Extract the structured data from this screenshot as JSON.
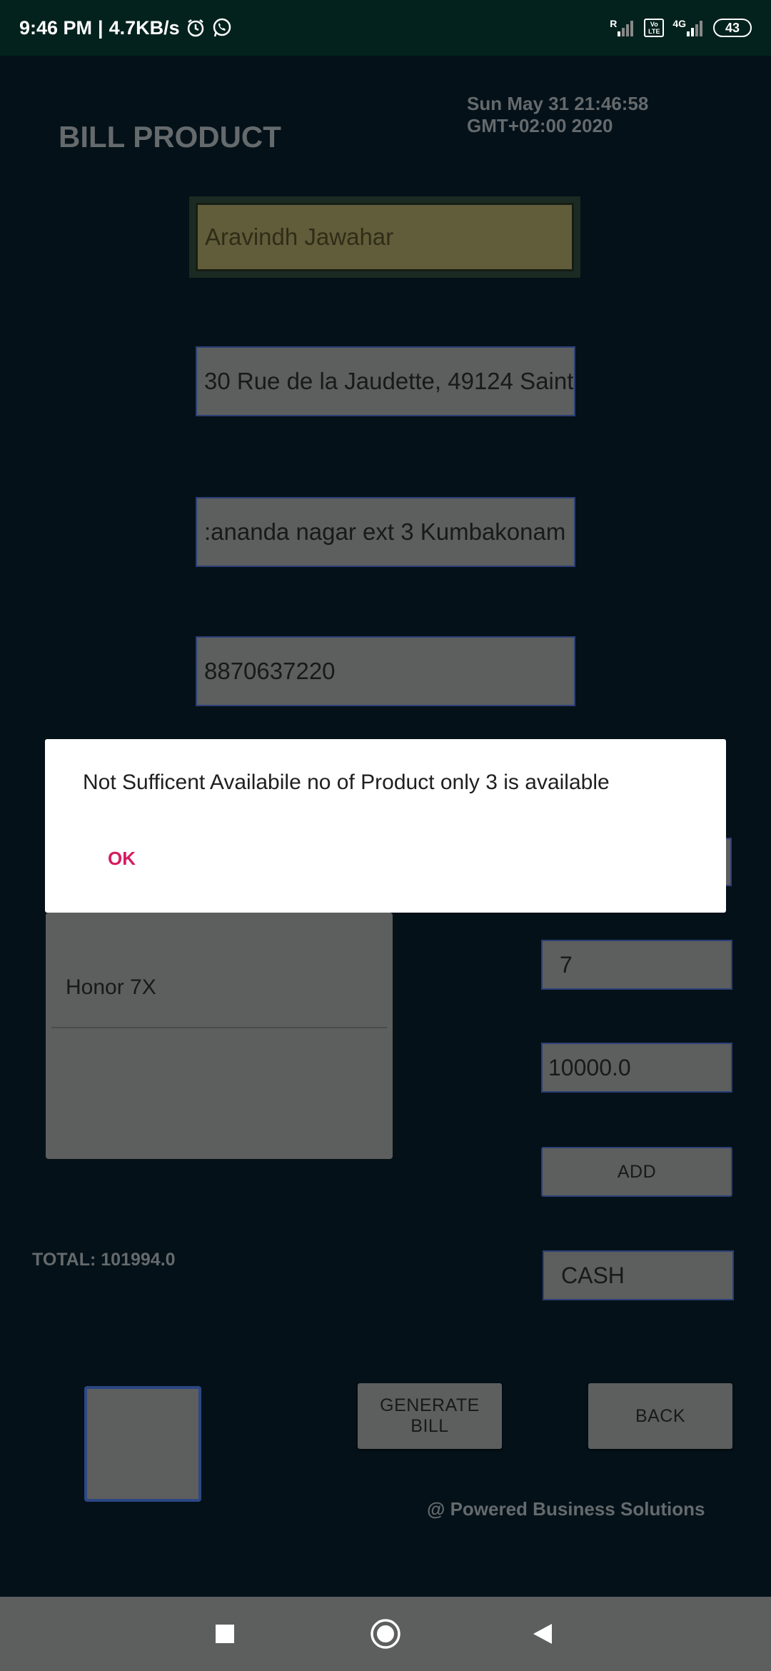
{
  "status_bar": {
    "time": "9:46 PM",
    "separator": "|",
    "net_speed": "4.7KB/s",
    "signal_label_r": "R",
    "volte_label": "Vo LTE",
    "network_label": "4G",
    "battery": "43"
  },
  "header": {
    "title": "BILL PRODUCT",
    "datetime_line1": "Sun May 31 21:46:58",
    "datetime_line2": "GMT+02:00 2020"
  },
  "form": {
    "name": "Aravindh Jawahar",
    "address1": "30 Rue de la Jaudette, 49124 Saint",
    "address2": ":ananda nagar ext 3 Kumbakonam",
    "phone": "8870637220"
  },
  "product_list": {
    "items": [
      "Honor 7X"
    ]
  },
  "quantity": "7",
  "price": "10000.0",
  "add_label": "ADD",
  "payment_method": "CASH",
  "total_label": "TOTAL: 101994.0",
  "generate_bill_line1": "GENERATE",
  "generate_bill_line2": "BILL",
  "back_label": "BACK",
  "footer": "@ Powered Business Solutions",
  "dialog": {
    "message": "Not Sufficent Availabile no of Product only 3 is available",
    "ok_label": "OK"
  },
  "colors": {
    "background": "#041118",
    "status_bar": "#03221d",
    "field_bg": "#5d5e5e",
    "field_border": "#2c3f78",
    "dim_text": "#656a6d",
    "dialog_accent": "#d81b60",
    "nav_bar": "#5d5e5e"
  },
  "icons": {
    "status_left": [
      "alarm-icon",
      "whatsapp-icon"
    ],
    "status_right": [
      "signal-icon",
      "volte-icon",
      "signal-4g-icon",
      "battery-icon"
    ],
    "nav": [
      "recents-square-icon",
      "home-circle-icon",
      "back-triangle-icon"
    ]
  }
}
